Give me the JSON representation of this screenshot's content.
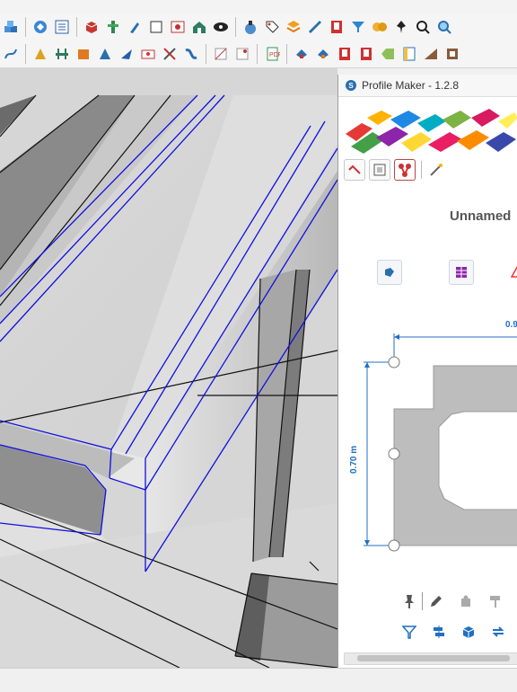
{
  "panel": {
    "title": "Profile Maker - 1.2.8",
    "profile_name": "Unnamed",
    "dimension_width": "0.9",
    "dimension_height": "0.70 m"
  },
  "toolbar_row1": [
    "cube-stack-icon",
    "inspector-icon",
    "list-icon",
    "box-icon",
    "tree-icon",
    "brush-icon",
    "rectangle-icon",
    "image-icon",
    "house-icon",
    "eye-icon",
    "flask-icon",
    "tag-icon",
    "layers-icon",
    "ruler-icon",
    "dw-icon",
    "filter-icon",
    "circles-icon",
    "pin-icon",
    "search-icon",
    "search2-icon"
  ],
  "toolbar_row2": [
    "path-icon",
    "draw-icon",
    "solid-icon",
    "cube-icon",
    "cut-icon",
    "shape-icon",
    "edit-icon",
    "scissors-icon",
    "curve-icon",
    "point1-icon",
    "point2-icon",
    "doc-icon",
    "sample1-icon",
    "sample2-icon",
    "dw2-icon",
    "dw3-icon",
    "label-icon",
    "panel-icon",
    "wedge-icon",
    "frame-icon"
  ],
  "colors": {
    "accent": "#1f6fc4",
    "edge": "#1010e0",
    "profile_fill": "#bdbdbd"
  }
}
